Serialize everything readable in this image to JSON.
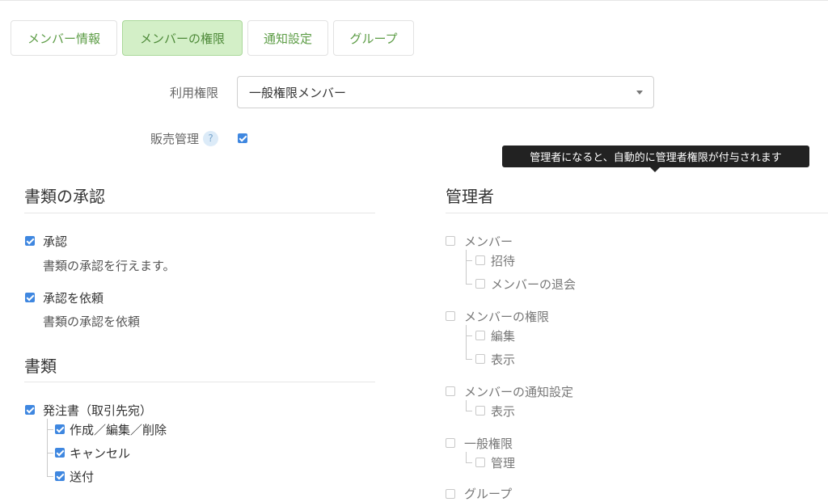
{
  "tabs": [
    {
      "label": "メンバー情報",
      "active": false
    },
    {
      "label": "メンバーの権限",
      "active": true
    },
    {
      "label": "通知設定",
      "active": false
    },
    {
      "label": "グループ",
      "active": false
    }
  ],
  "form": {
    "usage_label": "利用権限",
    "usage_value": "一般権限メンバー",
    "sales_label": "販売管理",
    "help_glyph": "?"
  },
  "tooltip": "管理者になると、自動的に管理者権限が付与されます",
  "left": {
    "approval_title": "書類の承認",
    "approve_label": "承認",
    "approve_desc": "書類の承認を行えます。",
    "request_label": "承認を依頼",
    "request_desc": "書類の承認を依頼",
    "documents_title": "書類",
    "po_label": "発注書（取引先宛）",
    "po_children": [
      "作成／編集／削除",
      "キャンセル",
      "送付"
    ]
  },
  "right": {
    "admin_title": "管理者",
    "members_label": "メンバー",
    "members_children": [
      "招待",
      "メンバーの退会"
    ],
    "perm_label": "メンバーの権限",
    "perm_children": [
      "編集",
      "表示"
    ],
    "notif_label": "メンバーの通知設定",
    "notif_children": [
      "表示"
    ],
    "general_label": "一般権限",
    "general_children": [
      "管理"
    ],
    "group_label": "グループ"
  },
  "colors": {
    "accent": "#3f87e0",
    "tab_active_bg": "#d3efc7",
    "tab_text": "#5c9c45"
  }
}
